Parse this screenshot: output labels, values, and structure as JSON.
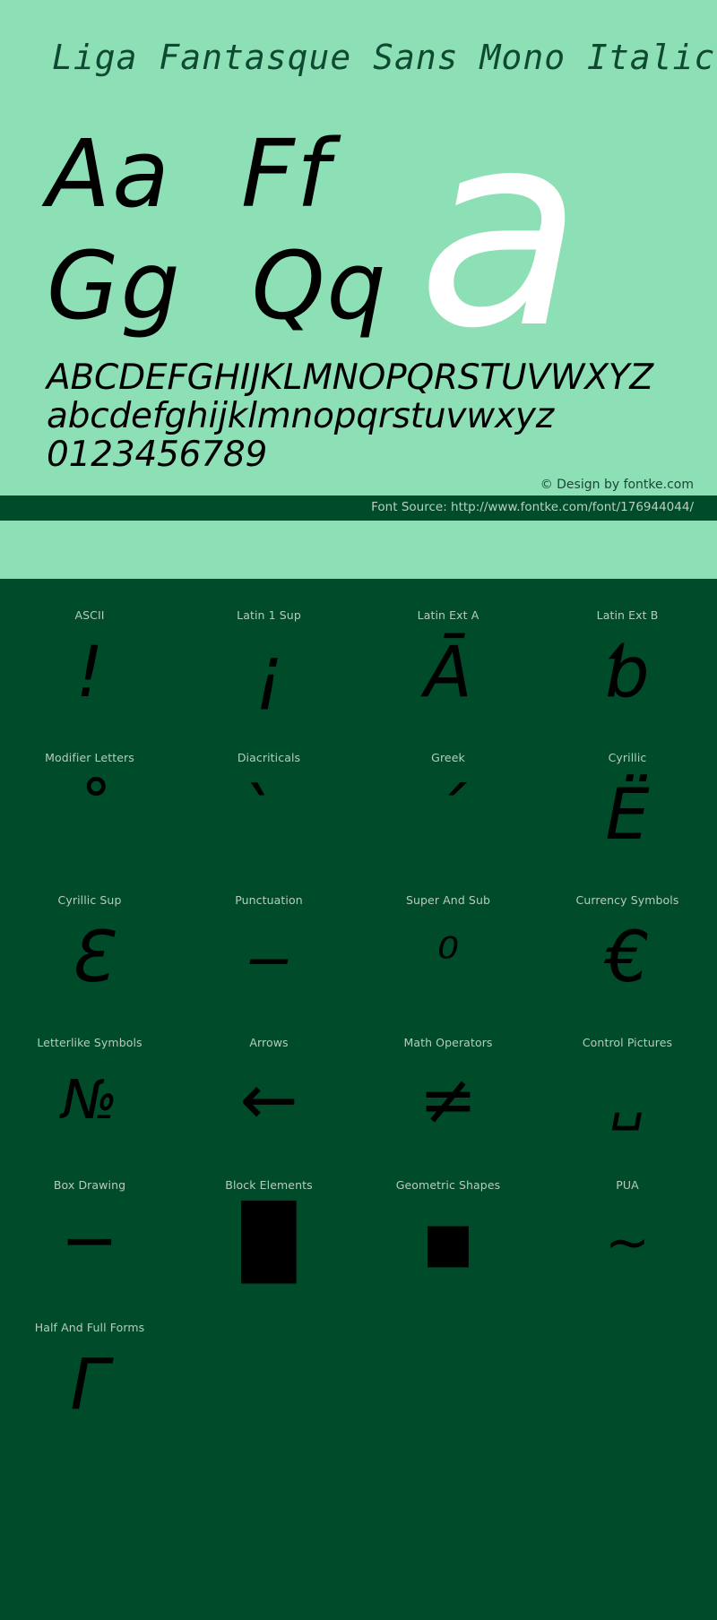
{
  "specimen": {
    "title": "Liga Fantasque Sans Mono Italic",
    "glyph_pairs": [
      "Aa",
      "Ff",
      "Gg",
      "Qq"
    ],
    "feature_glyph": "a",
    "waterfall": [
      "ABCDEFGHIJKLMNOPQRSTUVWXYZ",
      "abcdefghijklmnopqrstuvwxyz",
      "0123456789"
    ],
    "credit": "© Design by fontke.com",
    "source": "Font Source: http://www.fontke.com/font/176944044/",
    "colors": {
      "panel_background": "#8ddfb5",
      "title_text": "#0d4a31",
      "glyph": "#000000",
      "feature_glyph": "#ffffff",
      "dark_background": "#004b2a",
      "label_text": "#b7ccc0"
    }
  },
  "blocks": {
    "rows": [
      [
        {
          "label": "ASCII",
          "sample": "!",
          "size": "normal"
        },
        {
          "label": "Latin 1 Sup",
          "sample": "¡",
          "size": "normal"
        },
        {
          "label": "Latin Ext A",
          "sample": "Ā",
          "size": "normal"
        },
        {
          "label": "Latin Ext B",
          "sample": "ƅ",
          "size": "normal"
        }
      ],
      [
        {
          "label": "Modifier Letters",
          "sample": "˚",
          "size": "normal"
        },
        {
          "label": "Diacriticals",
          "sample": "̀",
          "size": "normal"
        },
        {
          "label": "Greek",
          "sample": "΄",
          "size": "normal"
        },
        {
          "label": "Cyrillic",
          "sample": "Ё",
          "size": "normal"
        }
      ],
      [
        {
          "label": "Cyrillic Sup",
          "sample": "Ɛ",
          "size": "normal"
        },
        {
          "label": "Punctuation",
          "sample": "‒",
          "size": "normal"
        },
        {
          "label": "Super And Sub",
          "sample": "⁰",
          "size": "sm"
        },
        {
          "label": "Currency Symbols",
          "sample": "€",
          "size": "normal"
        }
      ],
      [
        {
          "label": "Letterlike Symbols",
          "sample": "№",
          "size": "sm"
        },
        {
          "label": "Arrows",
          "sample": "←",
          "size": "normal"
        },
        {
          "label": "Math Operators",
          "sample": "≠",
          "size": "normal"
        },
        {
          "label": "Control Pictures",
          "sample": "␣",
          "size": "sm"
        }
      ],
      [
        {
          "label": "Box Drawing",
          "sample": "─",
          "size": "normal"
        },
        {
          "label": "Block Elements",
          "sample": "█",
          "size": "normal"
        },
        {
          "label": "Geometric Shapes",
          "sample": "■",
          "size": "sm"
        },
        {
          "label": "PUA",
          "sample": "~",
          "size": "sm"
        }
      ],
      [
        {
          "label": "Half And Full Forms",
          "sample": "Γ",
          "size": "normal"
        },
        {
          "label": "",
          "sample": "",
          "size": "normal"
        },
        {
          "label": "",
          "sample": "",
          "size": "normal"
        },
        {
          "label": "",
          "sample": "",
          "size": "normal"
        }
      ]
    ]
  }
}
